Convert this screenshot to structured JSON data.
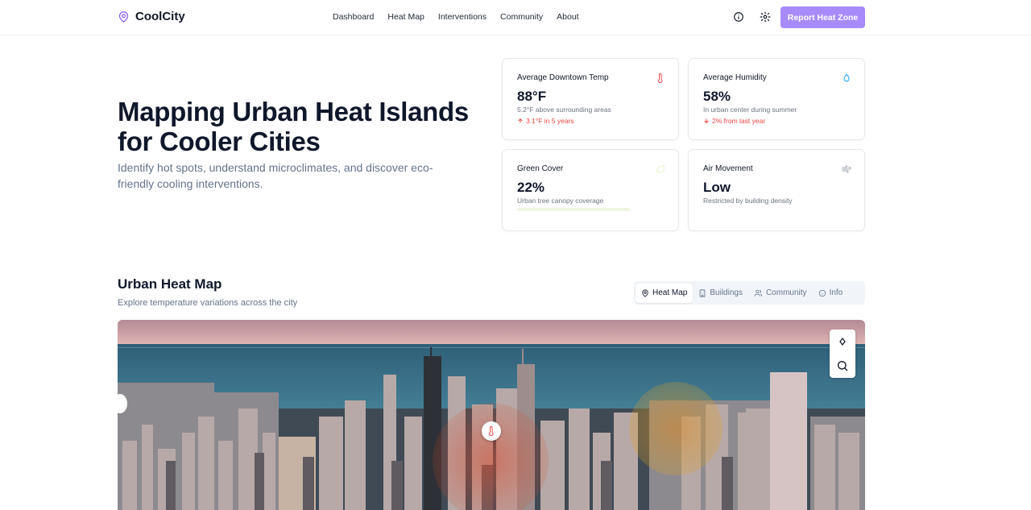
{
  "brand": {
    "name": "CoolCity"
  },
  "nav": [
    "Dashboard",
    "Heat Map",
    "Interventions",
    "Community",
    "About"
  ],
  "header": {
    "cta_label": "Report Heat Zone"
  },
  "hero": {
    "title": "Mapping Urban Heat Islands for Cooler Cities",
    "subtitle": "Identify hot spots, understand microclimates, and discover eco-friendly cooling interventions."
  },
  "stats": [
    {
      "label": "Average Downtown Temp",
      "value": "88°F",
      "desc": "5.2°F above surrounding areas",
      "trend": "3.1°F in 5 years",
      "trend_dir": "up",
      "icon": "thermometer-icon",
      "color": "#ef4444"
    },
    {
      "label": "Average Humidity",
      "value": "58%",
      "desc": "In urban center during summer",
      "trend": "2% from last year",
      "trend_dir": "down",
      "icon": "droplet-icon",
      "color": "#ef4444"
    },
    {
      "label": "Green Cover",
      "value": "22%",
      "desc": "Urban tree canopy coverage",
      "trend": "",
      "trend_dir": "up",
      "icon": "leaf-icon",
      "color": "#22c55e"
    },
    {
      "label": "Air Movement",
      "value": "Low",
      "desc": "Restricted by building density",
      "trend": "",
      "trend_dir": "",
      "icon": "wind-icon",
      "color": "#6b7280"
    }
  ],
  "map_section": {
    "title": "Urban Heat Map",
    "subtitle": "Explore temperature variations across the city",
    "tabs": [
      "Heat Map",
      "Buildings",
      "Community",
      "Info"
    ],
    "active_tab": "Heat Map"
  },
  "colors": {
    "accent": "#a78bfa",
    "hot": "#ef4444",
    "humidity": "#0ea5e9"
  }
}
